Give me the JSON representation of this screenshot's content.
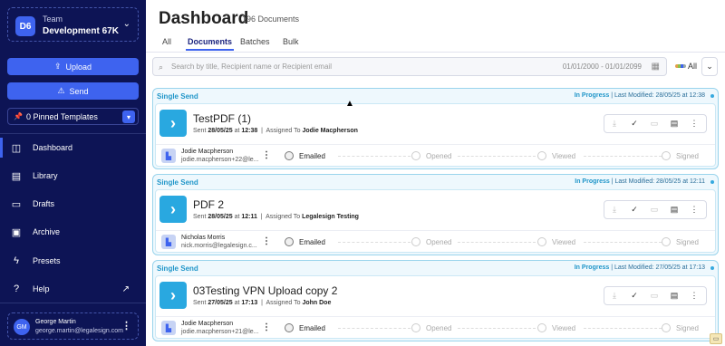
{
  "team": {
    "badge": "D6",
    "label": "Team",
    "name": "Development 67K"
  },
  "sidebar": {
    "upload_label": "Upload",
    "send_label": "Send",
    "pinned_label": "0 Pinned Templates",
    "nav": [
      {
        "label": "Dashboard",
        "icon": "dashboard-icon",
        "active": true
      },
      {
        "label": "Library",
        "icon": "library-icon"
      },
      {
        "label": "Drafts",
        "icon": "drafts-icon"
      },
      {
        "label": "Archive",
        "icon": "archive-icon"
      },
      {
        "label": "Presets",
        "icon": "presets-icon"
      },
      {
        "label": "Help",
        "icon": "help-icon"
      }
    ]
  },
  "user": {
    "initials": "GM",
    "name": "George Martin",
    "email": "george.martin@legalesign.com"
  },
  "header": {
    "title": "Dashboard",
    "count": "196 Documents"
  },
  "tabs": [
    "All",
    "Documents",
    "Batches",
    "Bulk"
  ],
  "active_tab": "Documents",
  "search": {
    "placeholder": "Search by title, Recipient name or Recipient email",
    "date_range": "01/01/2000 - 01/01/2099"
  },
  "filter": {
    "label": "All"
  },
  "steps": [
    "Emailed",
    "Opened",
    "Viewed",
    "Signed"
  ],
  "documents": [
    {
      "type": "Single Send",
      "status": "In Progress",
      "last_modified": "Last Modified: 28/05/25 at 12:38",
      "title": "TestPDF (1)",
      "sent_prefix": "Sent",
      "sent_date": "28/05/25",
      "sent_at": "at",
      "sent_time": "12:38",
      "assigned_prefix": "Assigned To",
      "assigned_to": "Jodie Macpherson",
      "recipient_name": "Jodie Macpherson",
      "recipient_email": "jodie.macpherson+22@le..."
    },
    {
      "type": "Single Send",
      "status": "In Progress",
      "last_modified": "Last Modified: 28/05/25 at 12:11",
      "title": "PDF 2",
      "sent_prefix": "Sent",
      "sent_date": "28/05/25",
      "sent_at": "at",
      "sent_time": "12:11",
      "assigned_prefix": "Assigned To",
      "assigned_to": "Legalesign Testing",
      "recipient_name": "Nicholas Morris",
      "recipient_email": "nick.morris@legalesign.c..."
    },
    {
      "type": "Single Send",
      "status": "In Progress",
      "last_modified": "Last Modified: 27/05/25 at 17:13",
      "title": "03Testing VPN Upload copy 2",
      "sent_prefix": "Sent",
      "sent_date": "27/05/25",
      "sent_at": "at",
      "sent_time": "17:13",
      "assigned_prefix": "Assigned To",
      "assigned_to": "John Doe",
      "recipient_name": "Jodie Macpherson",
      "recipient_email": "jodie.macpherson+21@le..."
    }
  ]
}
